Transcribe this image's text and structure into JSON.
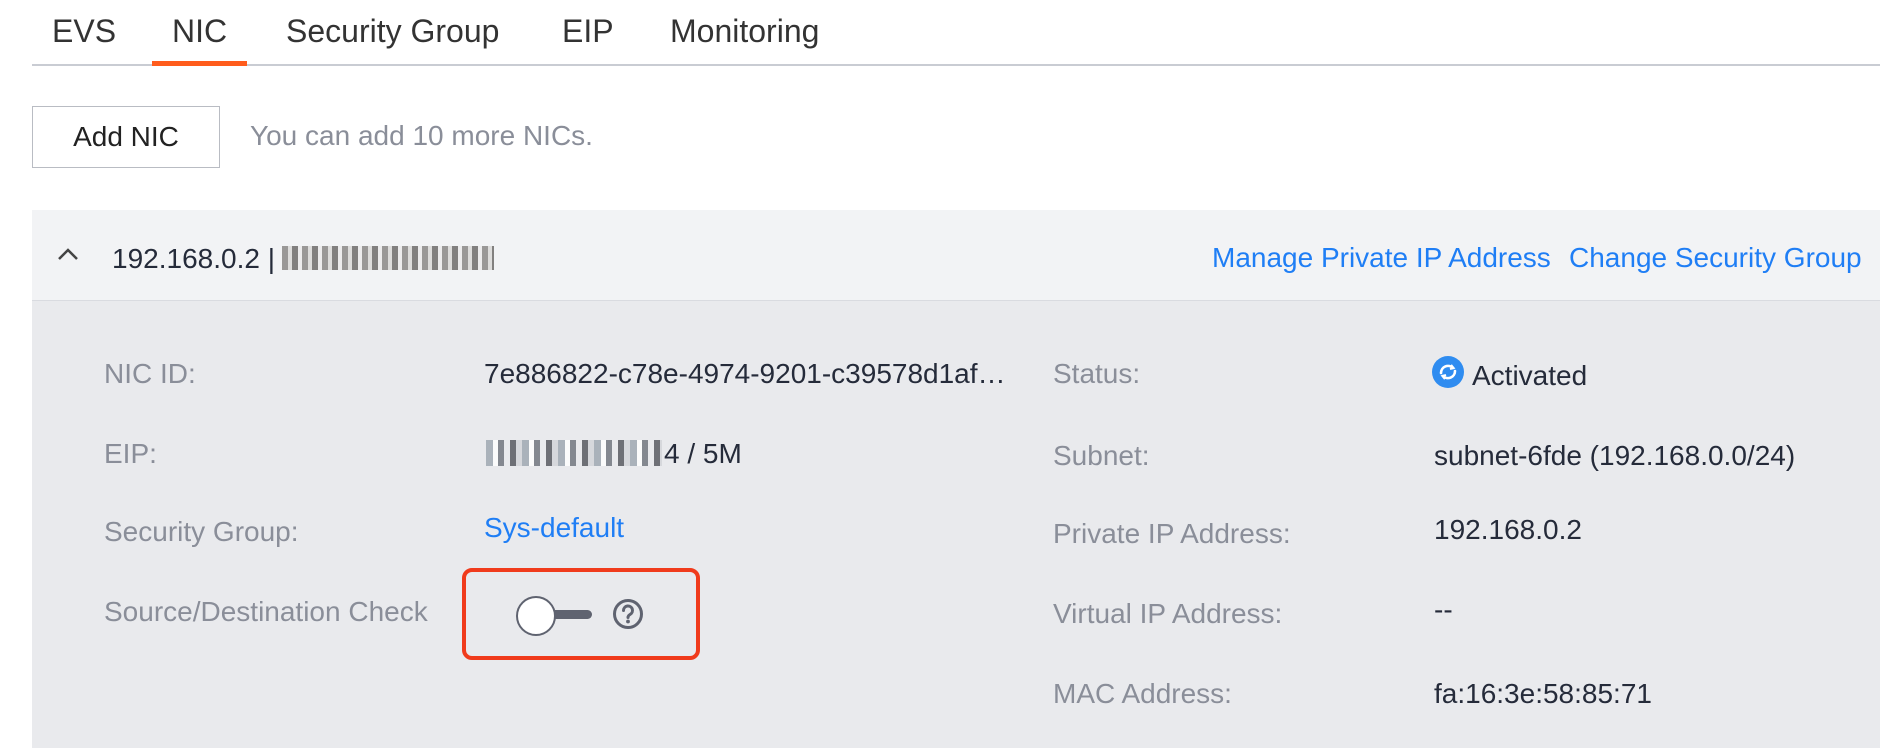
{
  "tabs": [
    {
      "label": "EVS",
      "active": false
    },
    {
      "label": "NIC",
      "active": true
    },
    {
      "label": "Security Group",
      "active": false
    },
    {
      "label": "EIP",
      "active": false
    },
    {
      "label": "Monitoring",
      "active": false
    }
  ],
  "toolbar": {
    "add_button_label": "Add NIC",
    "hint": "You can add 10 more NICs."
  },
  "nic": {
    "ip_title": "192.168.0.2 |",
    "actions": {
      "manage_private_ip": "Manage Private IP Address",
      "change_security_group": "Change Security Group"
    },
    "details": {
      "nic_id_label": "NIC ID:",
      "nic_id_value": "7e886822-c78e-4974-9201-c39578d1af…",
      "eip_label": "EIP:",
      "eip_value_suffix": "4 / 5M",
      "security_group_label": "Security Group:",
      "security_group_value": "Sys-default",
      "src_dst_check_label": "Source/Destination Check",
      "src_dst_check_enabled": false,
      "status_label": "Status:",
      "status_value": "Activated",
      "subnet_label": "Subnet:",
      "subnet_value": "subnet-6fde (192.168.0.0/24)",
      "private_ip_label": "Private IP Address:",
      "private_ip_value": "192.168.0.2",
      "virtual_ip_label": "Virtual IP Address:",
      "virtual_ip_value": "--",
      "mac_label": "MAC Address:",
      "mac_value": "fa:16:3e:58:85:71"
    }
  },
  "colors": {
    "accent": "#ff5c1c",
    "link": "#1f7ef5",
    "highlight": "#f03b1c",
    "status_icon": "#2f8cf0"
  },
  "icons": {
    "collapse": "chevron-up-icon",
    "help": "question-circle-icon",
    "status": "activated-status-icon"
  }
}
